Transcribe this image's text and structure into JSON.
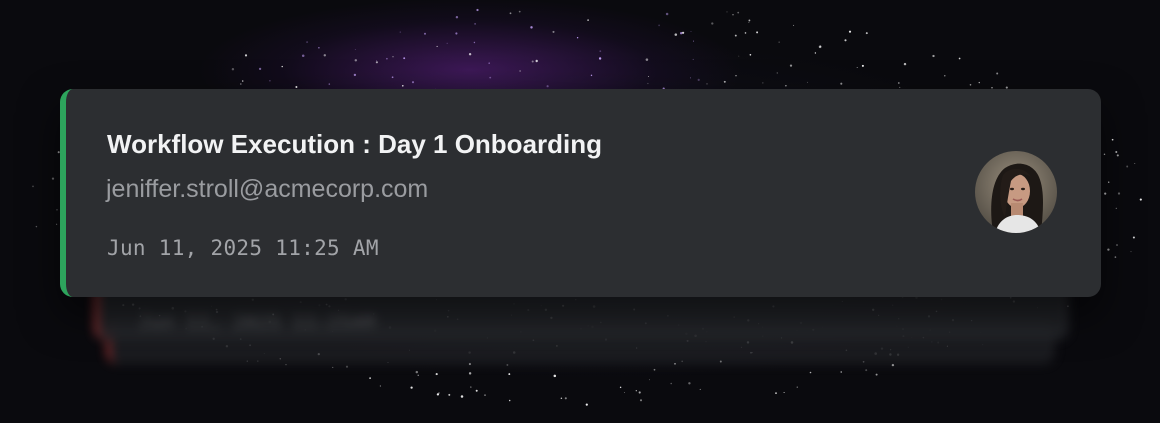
{
  "notification": {
    "title": "Workflow Execution : Day 1 Onboarding",
    "email": "jeniffer.stroll@acmecorp.com",
    "timestamp": "Jun 11, 2025 11:25 AM",
    "status_color": "#2da45c",
    "avatar_icon": "user-photo"
  },
  "stacked": {
    "timestamp_preview": "Jun 11, 2025 11:25AM",
    "status_color": "#b03a3a"
  }
}
